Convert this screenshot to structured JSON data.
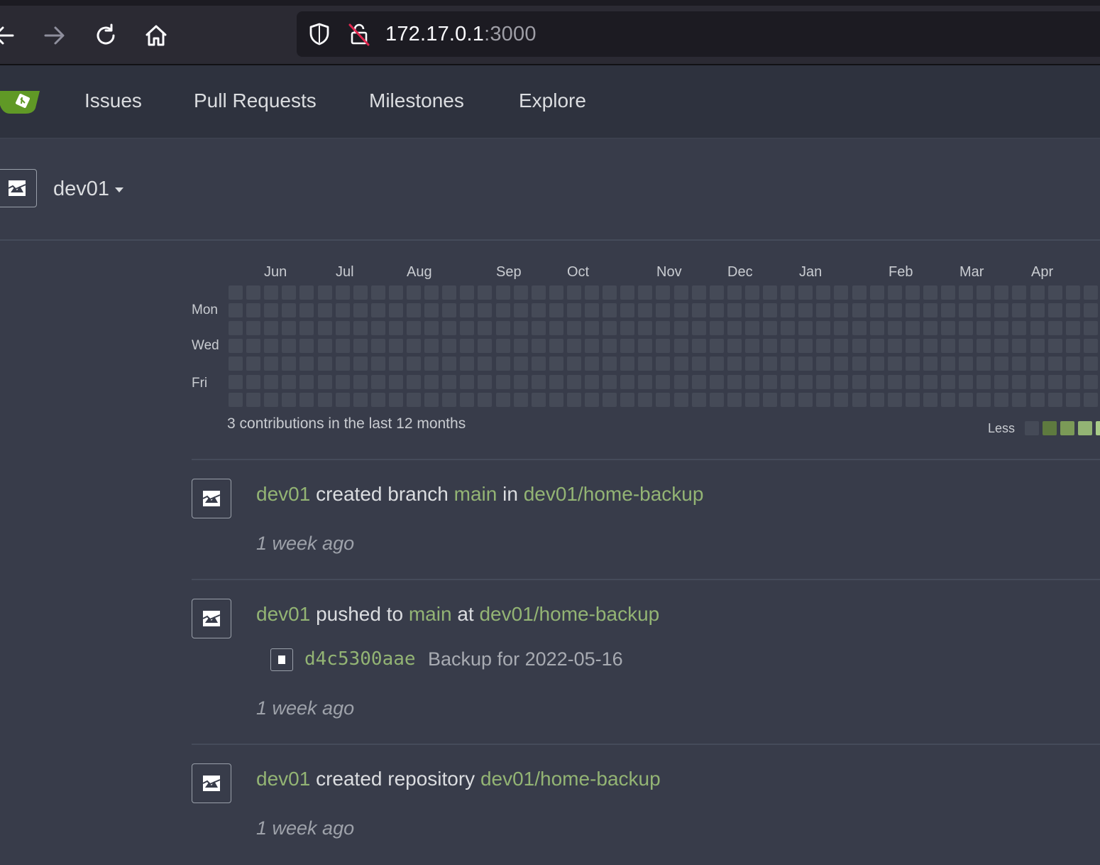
{
  "browser": {
    "url_host": "172.17.0.1",
    "url_port": ":3000"
  },
  "nav": {
    "items": [
      "Issues",
      "Pull Requests",
      "Milestones",
      "Explore"
    ]
  },
  "header": {
    "context_user": "dev01"
  },
  "heatmap": {
    "months": [
      "Jun",
      "Jul",
      "Aug",
      "Sep",
      "Oct",
      "Nov",
      "Dec",
      "Jan",
      "Feb",
      "Mar",
      "Apr"
    ],
    "days": [
      "Mon",
      "Wed",
      "Fri"
    ],
    "summary": "3 contributions in the last 12 months",
    "legend_less": "Less",
    "colors": {
      "empty": "#454a57",
      "level1": "#5e7a3f",
      "level2": "#7b9a57",
      "level3": "#93b474",
      "level4": "#a9cc88"
    }
  },
  "feed": {
    "items": [
      {
        "user": "dev01",
        "action": " created branch ",
        "ref": "main",
        "connector": " in ",
        "repo": "dev01/home-backup",
        "time": "1 week ago"
      },
      {
        "user": "dev01",
        "action": " pushed to ",
        "ref": "main",
        "connector": " at ",
        "repo": "dev01/home-backup",
        "commit_sha": "d4c5300aae",
        "commit_message": "Backup for 2022-05-16",
        "time": "1 week ago"
      },
      {
        "user": "dev01",
        "action": " created repository ",
        "repo": "dev01/home-backup",
        "time": "1 week ago"
      }
    ]
  },
  "accent_color": "#93b474"
}
